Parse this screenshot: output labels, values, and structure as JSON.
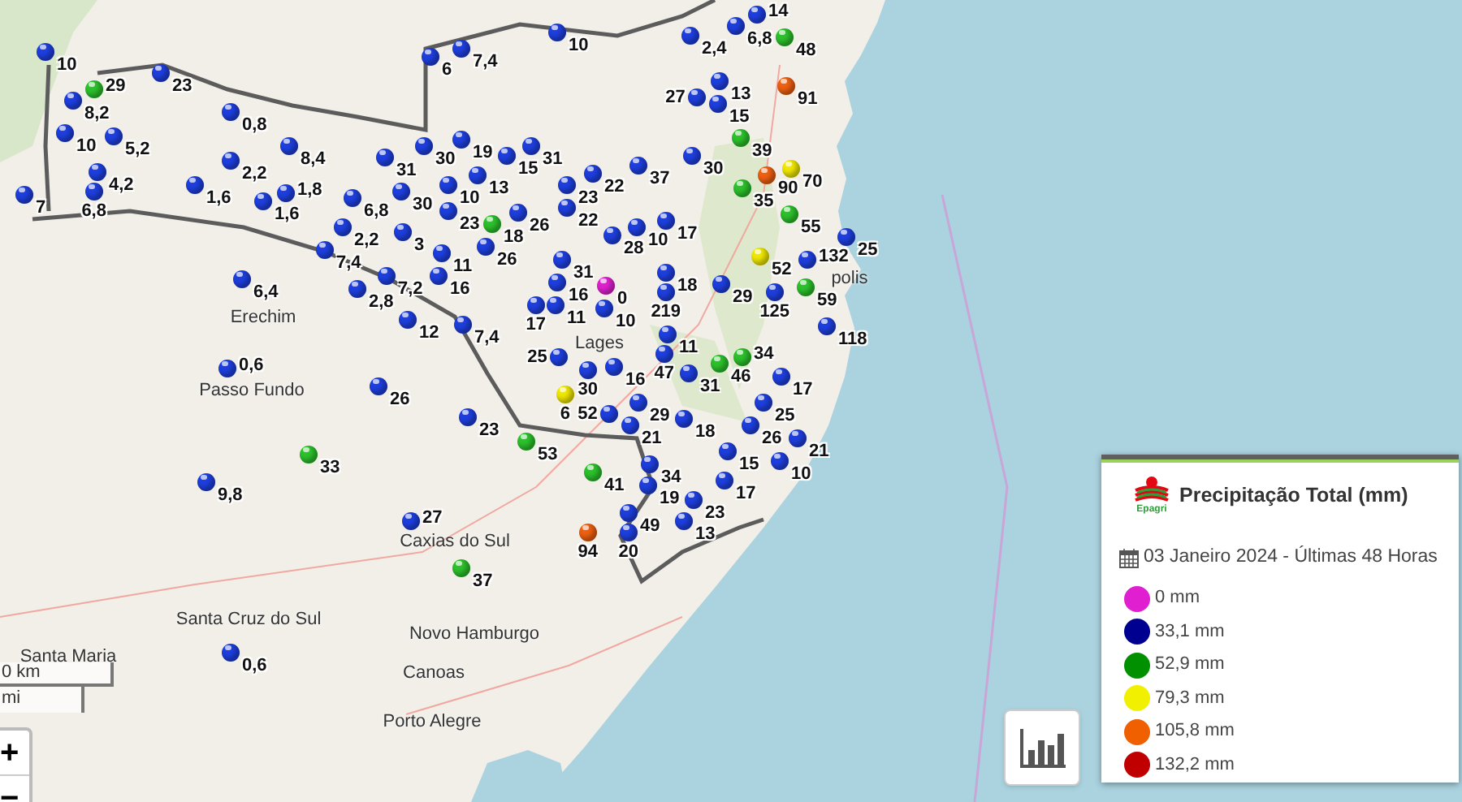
{
  "stations": [
    {
      "value": "10",
      "color": "#1e3fe0"
    },
    {
      "value": "23",
      "color": "#1e3fe0"
    },
    {
      "value": "8,2",
      "color": "#1e3fe0"
    },
    {
      "value": "29",
      "color": "#2cc22c"
    },
    {
      "value": "10",
      "color": "#1e3fe0"
    },
    {
      "value": "5,2",
      "color": "#1e3fe0"
    },
    {
      "value": "7",
      "color": "#1e3fe0"
    },
    {
      "value": "4,2",
      "color": "#1e3fe0"
    },
    {
      "value": "6,8",
      "color": "#1e3fe0"
    },
    {
      "value": "0,8",
      "color": "#1e3fe0"
    },
    {
      "value": "8,4",
      "color": "#1e3fe0"
    },
    {
      "value": "2,2",
      "color": "#1e3fe0"
    },
    {
      "value": "1,6",
      "color": "#1e3fe0"
    },
    {
      "value": "1,6",
      "color": "#1e3fe0"
    },
    {
      "value": "1,8",
      "color": "#1e3fe0"
    },
    {
      "value": "6,8",
      "color": "#1e3fe0"
    },
    {
      "value": "2,2",
      "color": "#1e3fe0"
    },
    {
      "value": "7,4",
      "color": "#1e3fe0"
    },
    {
      "value": "7,2",
      "color": "#1e3fe0"
    },
    {
      "value": "2,8",
      "color": "#1e3fe0"
    },
    {
      "value": "6,4",
      "color": "#1e3fe0"
    },
    {
      "value": "6",
      "color": "#1e3fe0"
    },
    {
      "value": "7,4",
      "color": "#1e3fe0"
    },
    {
      "value": "10",
      "color": "#1e3fe0"
    },
    {
      "value": "31",
      "color": "#1e3fe0"
    },
    {
      "value": "30",
      "color": "#1e3fe0"
    },
    {
      "value": "19",
      "color": "#1e3fe0"
    },
    {
      "value": "13",
      "color": "#1e3fe0"
    },
    {
      "value": "30",
      "color": "#1e3fe0"
    },
    {
      "value": "10",
      "color": "#1e3fe0"
    },
    {
      "value": "15",
      "color": "#1e3fe0"
    },
    {
      "value": "3",
      "color": "#1e3fe0"
    },
    {
      "value": "23",
      "color": "#1e3fe0"
    },
    {
      "value": "11",
      "color": "#1e3fe0"
    },
    {
      "value": "18",
      "color": "#2cc22c"
    },
    {
      "value": "26",
      "color": "#1e3fe0"
    },
    {
      "value": "16",
      "color": "#1e3fe0"
    },
    {
      "value": "26",
      "color": "#1e3fe0"
    },
    {
      "value": "31",
      "color": "#1e3fe0"
    },
    {
      "value": "23",
      "color": "#1e3fe0"
    },
    {
      "value": "22",
      "color": "#1e3fe0"
    },
    {
      "value": "22",
      "color": "#1e3fe0"
    },
    {
      "value": "28",
      "color": "#1e3fe0"
    },
    {
      "value": "31",
      "color": "#1e3fe0"
    },
    {
      "value": "16",
      "color": "#1e3fe0"
    },
    {
      "value": "11",
      "color": "#1e3fe0"
    },
    {
      "value": "0",
      "color": "#e020d0"
    },
    {
      "value": "17",
      "color": "#1e3fe0"
    },
    {
      "value": "10",
      "color": "#1e3fe0"
    },
    {
      "value": "17",
      "color": "#1e3fe0"
    },
    {
      "value": "18",
      "color": "#1e3fe0"
    },
    {
      "value": "219",
      "color": "#1e3fe0"
    },
    {
      "value": "29",
      "color": "#1e3fe0"
    },
    {
      "value": "37",
      "color": "#1e3fe0"
    },
    {
      "value": "30",
      "color": "#1e3fe0"
    },
    {
      "value": "10",
      "color": "#1e3fe0"
    },
    {
      "value": "11",
      "color": "#1e3fe0"
    },
    {
      "value": "16",
      "color": "#1e3fe0"
    },
    {
      "value": "30",
      "color": "#1e3fe0"
    },
    {
      "value": "47",
      "color": "#1e3fe0"
    },
    {
      "value": "31",
      "color": "#1e3fe0"
    },
    {
      "value": "6",
      "color": "#f0e800"
    },
    {
      "value": "25",
      "color": "#1e3fe0"
    },
    {
      "value": "29",
      "color": "#1e3fe0"
    },
    {
      "value": "21",
      "color": "#1e3fe0"
    },
    {
      "value": "52",
      "color": "#1e3fe0"
    },
    {
      "value": "53",
      "color": "#2cc22c"
    },
    {
      "value": "46",
      "color": "#2cc22c"
    },
    {
      "value": "34",
      "color": "#2cc22c"
    },
    {
      "value": "18",
      "color": "#1e3fe0"
    },
    {
      "value": "25",
      "color": "#1e3fe0"
    },
    {
      "value": "26",
      "color": "#1e3fe0"
    },
    {
      "value": "21",
      "color": "#1e3fe0"
    },
    {
      "value": "17",
      "color": "#1e3fe0"
    },
    {
      "value": "15",
      "color": "#1e3fe0"
    },
    {
      "value": "17",
      "color": "#1e3fe0"
    },
    {
      "value": "34",
      "color": "#1e3fe0"
    },
    {
      "value": "10",
      "color": "#1e3fe0"
    },
    {
      "value": "19",
      "color": "#1e3fe0"
    },
    {
      "value": "41",
      "color": "#2cc22c"
    },
    {
      "value": "49",
      "color": "#1e3fe0"
    },
    {
      "value": "20",
      "color": "#1e3fe0"
    },
    {
      "value": "13",
      "color": "#1e3fe0"
    },
    {
      "value": "23",
      "color": "#1e3fe0"
    },
    {
      "value": "94",
      "color": "#f06010"
    },
    {
      "value": "33",
      "color": "#2cc22c"
    },
    {
      "value": "0,6",
      "color": "#1e3fe0"
    },
    {
      "value": "26",
      "color": "#1e3fe0"
    },
    {
      "value": "12",
      "color": "#1e3fe0"
    },
    {
      "value": "7,4",
      "color": "#1e3fe0"
    },
    {
      "value": "23",
      "color": "#1e3fe0"
    },
    {
      "value": "9,8",
      "color": "#1e3fe0"
    },
    {
      "value": "27",
      "color": "#1e3fe0"
    },
    {
      "value": "37",
      "color": "#2cc22c"
    },
    {
      "value": "0,6",
      "color": "#1e3fe0"
    },
    {
      "value": "2,4",
      "color": "#1e3fe0"
    },
    {
      "value": "6,8",
      "color": "#1e3fe0"
    },
    {
      "value": "14",
      "color": "#1e3fe0"
    },
    {
      "value": "48",
      "color": "#2cc22c"
    },
    {
      "value": "13",
      "color": "#1e3fe0"
    },
    {
      "value": "15",
      "color": "#1e3fe0"
    },
    {
      "value": "27",
      "color": "#1e3fe0"
    },
    {
      "value": "91",
      "color": "#f06010"
    },
    {
      "value": "39",
      "color": "#2cc22c"
    },
    {
      "value": "90",
      "color": "#f06010"
    },
    {
      "value": "70",
      "color": "#f0e800"
    },
    {
      "value": "35",
      "color": "#2cc22c"
    },
    {
      "value": "55",
      "color": "#2cc22c"
    },
    {
      "value": "52",
      "color": "#f0e800"
    },
    {
      "value": "132",
      "color": "#1e3fe0"
    },
    {
      "value": "59",
      "color": "#2cc22c"
    },
    {
      "value": "125",
      "color": "#1e3fe0"
    },
    {
      "value": "25",
      "color": "#1e3fe0"
    },
    {
      "value": "118",
      "color": "#1e3fe0"
    }
  ],
  "cities": [
    "Erechim",
    "Passo Fundo",
    "Lages",
    "polis",
    "Caxias do Sul",
    "Santa Cruz do Sul",
    "Santa Maria",
    "Novo Hamburgo",
    "Canoas",
    "Porto Alegre"
  ],
  "scale": {
    "metric": "0 km",
    "imperial": "mi"
  },
  "zoom_controls": [
    "+",
    "−"
  ],
  "legend": {
    "title": "Precipitação Total (mm)",
    "logo_text": "Epagri",
    "date": "03 Janeiro 2024 - Últimas 48 Horas",
    "items": [
      {
        "label": "0 mm",
        "color": "#e020d0"
      },
      {
        "label": "33,1 mm",
        "color": "#000090"
      },
      {
        "label": "52,9 mm",
        "color": "#009000"
      },
      {
        "label": "79,3 mm",
        "color": "#f0f000"
      },
      {
        "label": "105,8 mm",
        "color": "#f06000"
      },
      {
        "label": "132,2 mm",
        "color": "#c00000"
      }
    ]
  }
}
